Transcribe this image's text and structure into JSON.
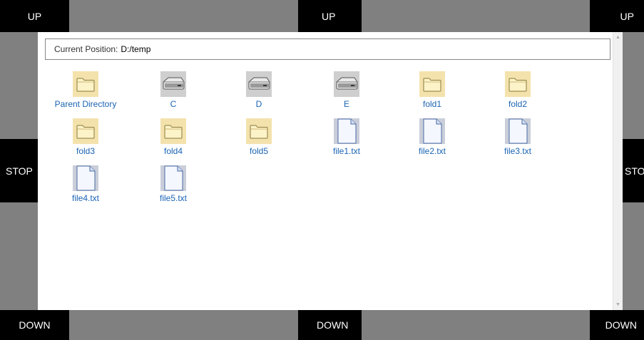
{
  "controls": {
    "up_left": "UP",
    "up_center": "UP",
    "up_right": "UP",
    "stop_left": "STOP",
    "stop_right": "STOP",
    "down_left": "DOWN",
    "down_center": "DOWN",
    "down_right": "DOWN"
  },
  "path_bar": {
    "label": "Current Position:",
    "value": "D:/temp"
  },
  "items": [
    {
      "name": "Parent Directory",
      "icon": "folder-icon"
    },
    {
      "name": "C",
      "icon": "drive-icon"
    },
    {
      "name": "D",
      "icon": "drive-icon"
    },
    {
      "name": "E",
      "icon": "drive-icon"
    },
    {
      "name": "fold1",
      "icon": "folder-icon"
    },
    {
      "name": "fold2",
      "icon": "folder-icon"
    },
    {
      "name": "fold3",
      "icon": "folder-icon"
    },
    {
      "name": "fold4",
      "icon": "folder-icon"
    },
    {
      "name": "fold5",
      "icon": "folder-icon"
    },
    {
      "name": "file1.txt",
      "icon": "file-icon"
    },
    {
      "name": "file2.txt",
      "icon": "file-icon"
    },
    {
      "name": "file3.txt",
      "icon": "file-icon"
    },
    {
      "name": "file4.txt",
      "icon": "file-icon"
    },
    {
      "name": "file5.txt",
      "icon": "file-icon"
    }
  ],
  "colors": {
    "background": "#808080",
    "control": "#000000",
    "link": "#1a64b4",
    "folder": "#f7e3a6"
  }
}
